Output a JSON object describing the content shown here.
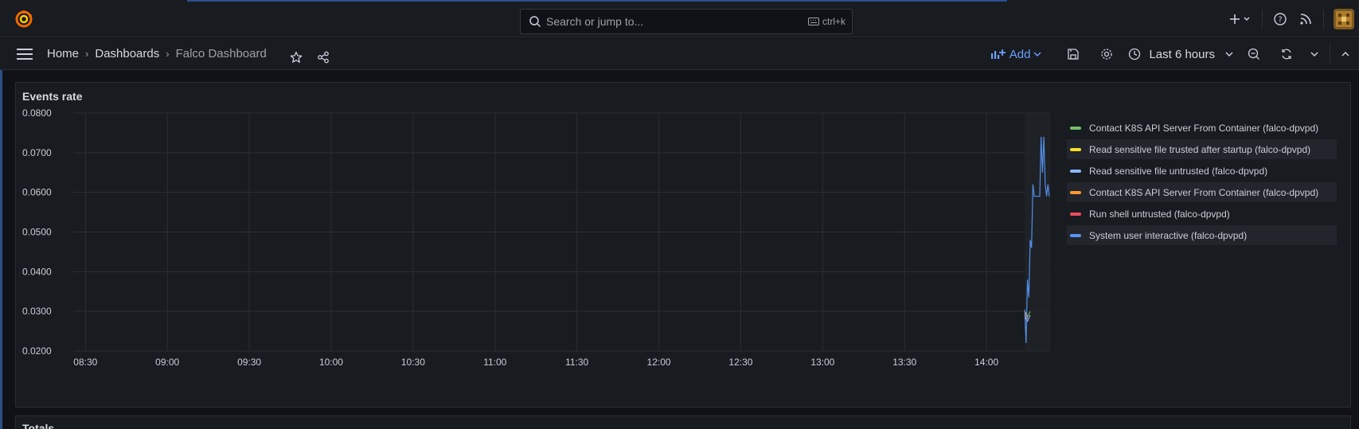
{
  "topbar": {
    "search_placeholder": "Search or jump to...",
    "search_shortcut": "ctrl+k"
  },
  "breadcrumb": {
    "home": "Home",
    "dashboards": "Dashboards",
    "current": "Falco Dashboard"
  },
  "toolbar": {
    "add_label": "Add",
    "time_range": "Last 6 hours"
  },
  "panel": {
    "title": "Events rate"
  },
  "next_panel": {
    "title": "Totals"
  },
  "colors": {
    "accent": "#6e9fff",
    "green": "#73bf69",
    "yellow": "#fade2a",
    "cyan": "#8ab8ff",
    "orange": "#ff9830",
    "red": "#f2495c",
    "blue": "#5794f2"
  },
  "chart_data": {
    "type": "line",
    "title": "Events rate",
    "xlabel": "",
    "ylabel": "",
    "ylim": [
      0.02,
      0.08
    ],
    "y_ticks": [
      "0.0800",
      "0.0700",
      "0.0600",
      "0.0500",
      "0.0400",
      "0.0300",
      "0.0200"
    ],
    "x_ticks": [
      "08:30",
      "09:00",
      "09:30",
      "10:00",
      "10:30",
      "11:00",
      "11:30",
      "12:00",
      "12:30",
      "13:00",
      "13:30",
      "14:00"
    ],
    "xlim": [
      "08:20",
      "14:23"
    ],
    "grid": true,
    "legend_position": "right",
    "series": [
      {
        "name": "Contact K8S API Server From Container (falco-dpvpd)",
        "color": "#73bf69",
        "x": [
          "14:14",
          "14:15",
          "14:16"
        ],
        "values": [
          0.0295,
          0.0285,
          0.03
        ]
      },
      {
        "name": "Read sensitive file trusted after startup (falco-dpvpd)",
        "color": "#fade2a",
        "x": [
          "14:14",
          "14:15"
        ],
        "values": [
          0.029,
          0.028
        ]
      },
      {
        "name": "Read sensitive file untrusted (falco-dpvpd)",
        "color": "#8ab8ff",
        "x": [
          "14:14",
          "14:15",
          "14:16"
        ],
        "values": [
          0.0285,
          0.0275,
          0.029
        ]
      },
      {
        "name": "Contact K8S API Server From Container (falco-dpvpd)",
        "color": "#ff9830",
        "x": [
          "14:14",
          "14:15"
        ],
        "values": [
          0.03,
          0.0288
        ]
      },
      {
        "name": "Run shell untrusted (falco-dpvpd)",
        "color": "#f2495c",
        "x": [
          "14:14",
          "14:15"
        ],
        "values": [
          0.0292,
          0.0282
        ]
      },
      {
        "name": "System user interactive (falco-dpvpd)",
        "color": "#5794f2",
        "x": [
          "14:14",
          "14:14.5",
          "14:15",
          "14:15.5",
          "14:16",
          "14:16.5",
          "14:17",
          "14:17.5",
          "14:18",
          "14:18.5",
          "14:19",
          "14:19.5",
          "14:20",
          "14:20.5",
          "14:21",
          "14:21.5",
          "14:22",
          "14:22.5",
          "14:23"
        ],
        "values": [
          0.0305,
          0.022,
          0.038,
          0.0335,
          0.048,
          0.046,
          0.062,
          0.059,
          0.059,
          0.059,
          0.059,
          0.059,
          0.074,
          0.065,
          0.074,
          0.062,
          0.059,
          0.062,
          0.059
        ]
      }
    ]
  }
}
